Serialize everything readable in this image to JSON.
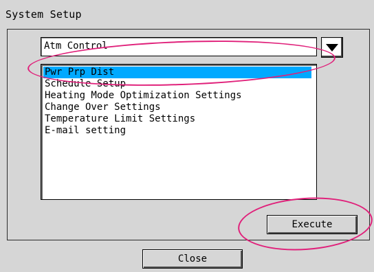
{
  "window": {
    "title": "System Setup"
  },
  "dropdown": {
    "selected_value": "Atm Control"
  },
  "list": {
    "items": [
      {
        "label": "Pwr Prp Dist",
        "selected": true
      },
      {
        "label": "Schedule Setup",
        "selected": false
      },
      {
        "label": "Heating Mode Optimization Settings",
        "selected": false
      },
      {
        "label": "Change Over Settings",
        "selected": false
      },
      {
        "label": "Temperature Limit Settings",
        "selected": false
      },
      {
        "label": "E-mail setting",
        "selected": false
      }
    ]
  },
  "buttons": {
    "execute_label": "Execute",
    "close_label": "Close"
  },
  "colors": {
    "background": "#d6d6d6",
    "selection": "#00a9ff",
    "annotation": "#e0207a"
  }
}
